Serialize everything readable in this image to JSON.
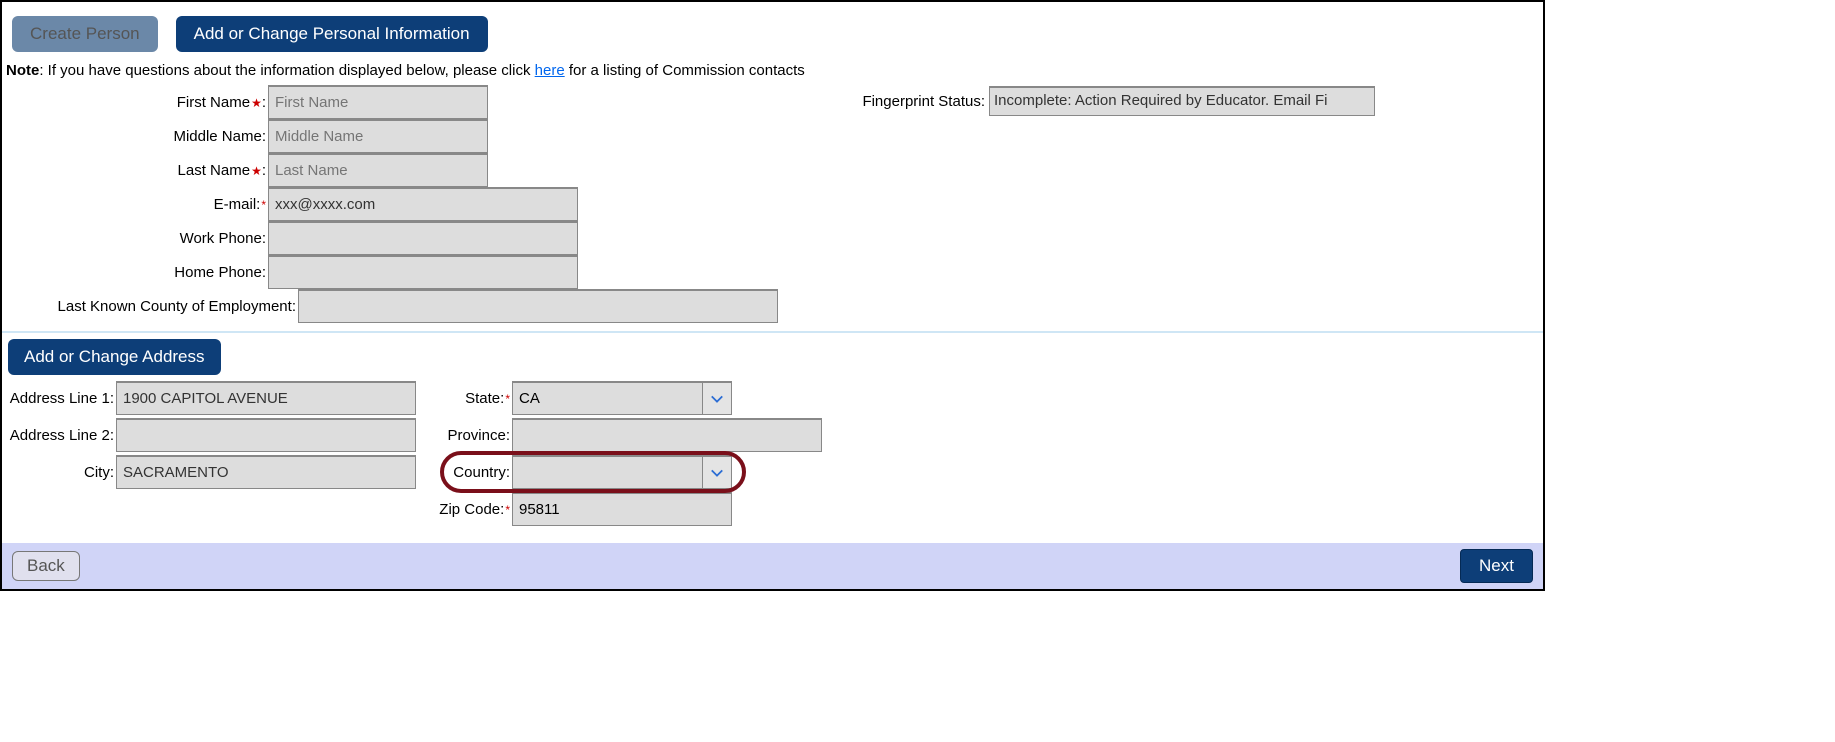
{
  "tabs": {
    "create_person": "Create Person",
    "personal_info": "Add or Change Personal Information"
  },
  "note": {
    "prefix": "Note",
    "body1": ": If you have questions about the information displayed below, please click ",
    "link": "here",
    "body2": " for a listing of Commission contacts"
  },
  "personal": {
    "first_name_label": "First Name",
    "first_name_ph": "First Name",
    "middle_name_label": "Middle Name:",
    "middle_name_ph": "Middle Name",
    "last_name_label": "Last Name",
    "last_name_ph": "Last Name",
    "email_label": "E-mail:",
    "email_val": "xxx@xxxx.com",
    "work_phone_label": "Work Phone:",
    "work_phone_val": "",
    "home_phone_label": "Home Phone:",
    "home_phone_val": "",
    "county_label": "Last Known County of Employment:",
    "county_val": ""
  },
  "fingerprint": {
    "label": "Fingerprint Status:",
    "value": "Incomplete: Action Required by Educator. Email Fi"
  },
  "address_header": "Add or Change Address",
  "address": {
    "line1_label": "Address Line 1:",
    "line1_val": "1900 CAPITOL AVENUE",
    "line2_label": "Address Line 2:",
    "line2_val": "",
    "city_label": "City:",
    "city_val": "SACRAMENTO",
    "state_label": "State:",
    "state_val": "CA",
    "province_label": "Province:",
    "province_val": "",
    "country_label": "Country:",
    "country_val": "",
    "zip_label": "Zip Code:",
    "zip_val": "95811"
  },
  "footer": {
    "back": "Back",
    "next": "Next"
  }
}
